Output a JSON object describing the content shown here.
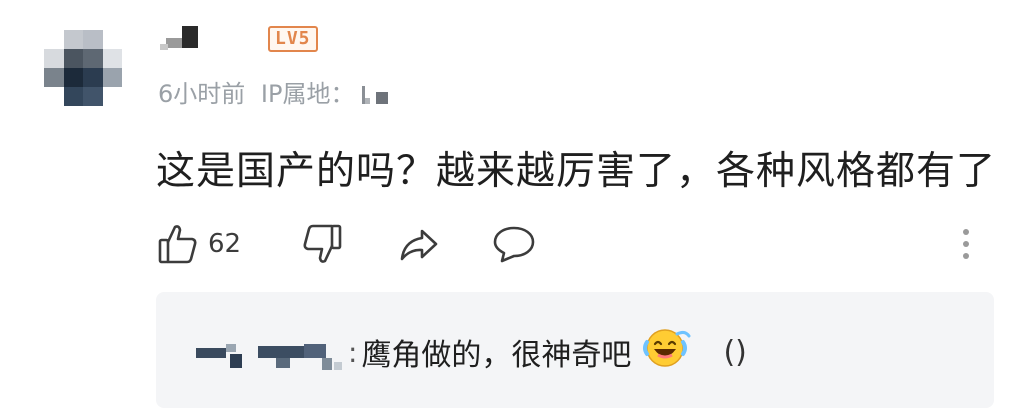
{
  "comment": {
    "level_badge": "LV5",
    "time": "6小时前",
    "ip_label": "IP属地：",
    "ip_value": "",
    "text": "这是国产的吗？越来越厉害了，各种风格都有了",
    "like_count": "62",
    "icons": {
      "like": "thumbs-up-icon",
      "dislike": "thumbs-down-icon",
      "share": "share-arrow-icon",
      "reply": "chat-bubble-icon",
      "more": "more-vertical-icon"
    }
  },
  "reply": {
    "separator": ":",
    "text": "鹰角做的，很神奇吧",
    "emoji": "laughing-crying-emoji",
    "parens": "()"
  },
  "colors": {
    "level_badge": "#e2864c",
    "meta_text": "#9aa0a6",
    "icon": "#3c3c3c",
    "reply_bg": "#f4f5f7",
    "emoji_fill": "#ffcc33"
  }
}
